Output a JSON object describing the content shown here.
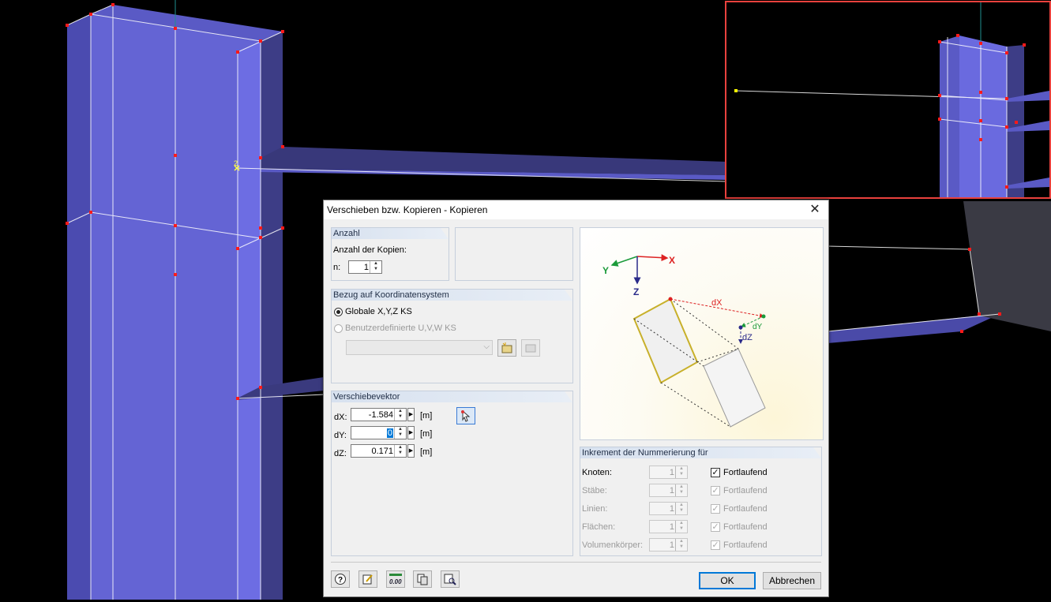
{
  "viewport": {
    "node_label": "2"
  },
  "colors": {
    "accent": "#e8413d",
    "member_fill": "#6a6adf",
    "node": "#ff1a1a"
  },
  "dialog": {
    "title": "Verschieben bzw. Kopieren - Kopieren",
    "close_icon": "close-icon",
    "anzahl": {
      "header": "Anzahl",
      "label": "Anzahl der Kopien:",
      "n_label": "n:",
      "n_value": "1"
    },
    "bezug": {
      "header": "Bezug auf Koordinatensystem",
      "option_global": "Globale X,Y,Z KS",
      "option_user": "Benutzerdefinierte U,V,W KS",
      "selected": "global"
    },
    "vektor": {
      "header": "Verschiebevektor",
      "dx_label": "dX:",
      "dx_value": "-1.584",
      "dy_label": "dY:",
      "dy_value": "0",
      "dz_label": "dZ:",
      "dz_value": "0.171",
      "unit": "[m]"
    },
    "figure": {
      "axis_x": "X",
      "axis_y": "Y",
      "axis_z": "Z",
      "dx": "dX",
      "dy": "dY",
      "dz": "dZ"
    },
    "inkrement": {
      "header": "Inkrement der Nummerierung für",
      "rows": [
        {
          "label": "Knoten:",
          "value": "1",
          "check_label": "Fortlaufend",
          "checked": true,
          "enabled": true
        },
        {
          "label": "Stäbe:",
          "value": "1",
          "check_label": "Fortlaufend",
          "checked": true,
          "enabled": false
        },
        {
          "label": "Linien:",
          "value": "1",
          "check_label": "Fortlaufend",
          "checked": true,
          "enabled": false
        },
        {
          "label": "Flächen:",
          "value": "1",
          "check_label": "Fortlaufend",
          "checked": true,
          "enabled": false
        },
        {
          "label": "Volumenkörper:",
          "value": "1",
          "check_label": "Fortlaufend",
          "checked": true,
          "enabled": false
        }
      ]
    },
    "footer": {
      "ok": "OK",
      "cancel": "Abbrechen",
      "icon_calc_label": "0.00"
    }
  }
}
